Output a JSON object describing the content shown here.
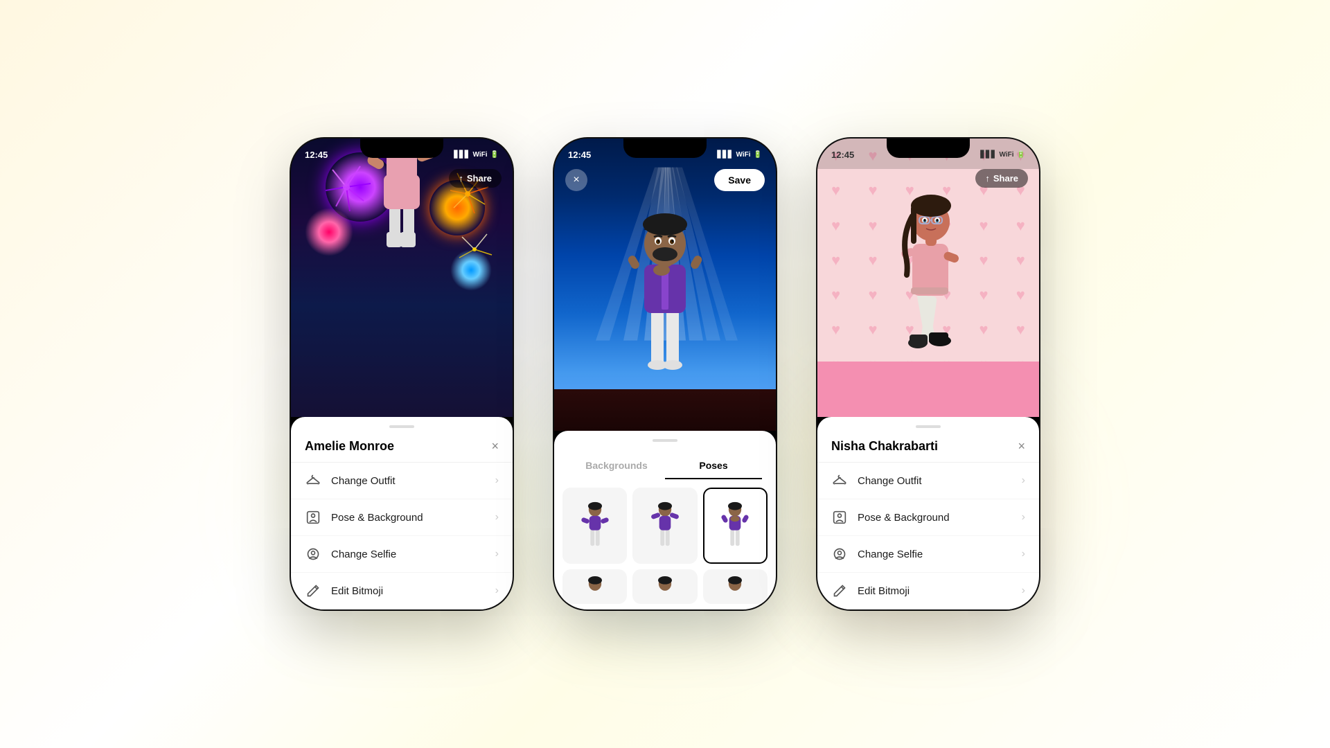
{
  "phones": [
    {
      "id": "phone-amelie",
      "statusTime": "12:45",
      "character": "Amelie Monroe",
      "shareLabel": "Share",
      "background": "fireworks",
      "menuItems": [
        {
          "icon": "hanger",
          "label": "Change Outfit"
        },
        {
          "icon": "camera-frame",
          "label": "Pose & Background"
        },
        {
          "icon": "face",
          "label": "Change Selfie"
        },
        {
          "icon": "pencil",
          "label": "Edit Bitmoji"
        }
      ]
    },
    {
      "id": "phone-center",
      "statusTime": "12:45",
      "character": "Bitmoji Male",
      "saveLabel": "Save",
      "closeLabel": "×",
      "background": "stage",
      "tabs": [
        "Backgrounds",
        "Poses"
      ],
      "activeTab": "Poses",
      "poses": [
        "pose1",
        "pose2",
        "pose3",
        "pose4",
        "pose5",
        "pose6"
      ]
    },
    {
      "id": "phone-nisha",
      "statusTime": "12:45",
      "character": "Nisha Chakrabarti",
      "shareLabel": "Share",
      "background": "hearts",
      "menuItems": [
        {
          "icon": "hanger",
          "label": "Change Outfit"
        },
        {
          "icon": "camera-frame",
          "label": "Pose & Background"
        },
        {
          "icon": "face",
          "label": "Change Selfie"
        },
        {
          "icon": "pencil",
          "label": "Edit Bitmoji"
        }
      ]
    }
  ],
  "icons": {
    "share": "↑",
    "close": "×",
    "arrow": "›",
    "hanger": "👕",
    "face": "😊",
    "pencil": "✏"
  }
}
